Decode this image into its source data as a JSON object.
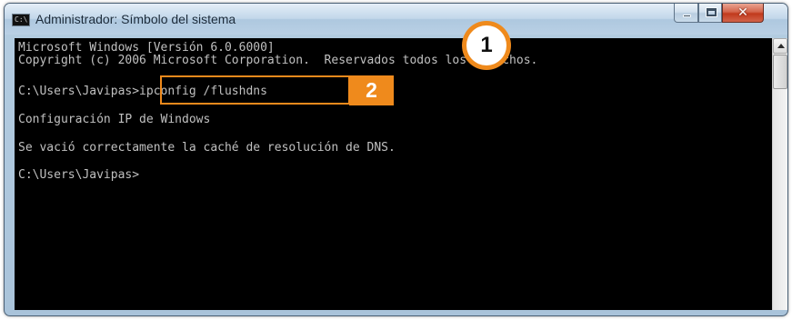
{
  "window": {
    "title": "Administrador: Símbolo del sistema",
    "icon_label": "C:\\",
    "close_glyph": "✕"
  },
  "console": {
    "lines": [
      "Microsoft Windows [Versión 6.0.6000]",
      "Copyright (c) 2006 Microsoft Corporation.  Reservados todos los derechos.",
      "C:\\Users\\Javipas>ipconfig /flushdns",
      "Configuración IP de Windows",
      "Se vació correctamente la caché de resolución de DNS.",
      "C:\\Users\\Javipas>"
    ]
  },
  "callouts": {
    "one": "1",
    "two": "2"
  },
  "colors": {
    "callout_accent": "#ef8a1c",
    "console_background": "#000000",
    "console_text": "#c0c0c0"
  },
  "icons": [
    "console-app-icon",
    "minimize-icon",
    "maximize-icon",
    "close-icon",
    "scroll-up-arrow-icon"
  ]
}
